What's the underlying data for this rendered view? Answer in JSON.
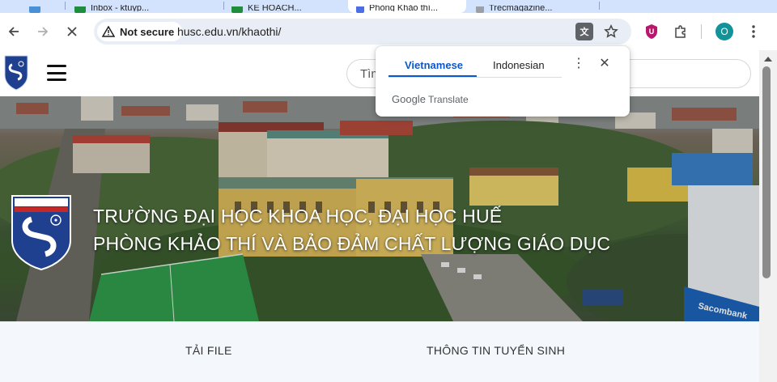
{
  "tabs": [
    {
      "title": "",
      "favicon_color": "#4a90d9"
    },
    {
      "title": "Inbox - ktuyp...",
      "favicon_color": "#1e8e3e"
    },
    {
      "title": "KẾ HOẠCH...",
      "favicon_color": "#1e8e3e"
    },
    {
      "title": "Phòng Khảo thí...",
      "favicon_color": "#4a6fe3",
      "active": true
    },
    {
      "title": "Trecmagazine...",
      "favicon_color": "#9aa0a6"
    }
  ],
  "toolbar": {
    "security_label": "Not secure",
    "url": "husc.edu.vn/khaothi/"
  },
  "site": {
    "search_placeholder": "Tìm",
    "hero_line1": "TRƯỜNG ĐẠI HỌC KHOA HỌC, ĐẠI HỌC HUẾ",
    "hero_line2": "PHÒNG KHẢO THÍ VÀ BẢO ĐẢM CHẤT LƯỢNG GIÁO DỤC",
    "sign_text": "Sacombank",
    "nav": [
      "TẢI FILE",
      "THÔNG TIN TUYỂN SINH"
    ]
  },
  "translate_popup": {
    "languages": [
      "Vietnamese",
      "Indonesian"
    ],
    "brand_google": "Google",
    "brand_translate": "Translate"
  },
  "profile_initial": "O",
  "colors": {
    "tabstrip": "#d3e3fd",
    "accent": "#0b57d0",
    "profile": "#12939a"
  }
}
